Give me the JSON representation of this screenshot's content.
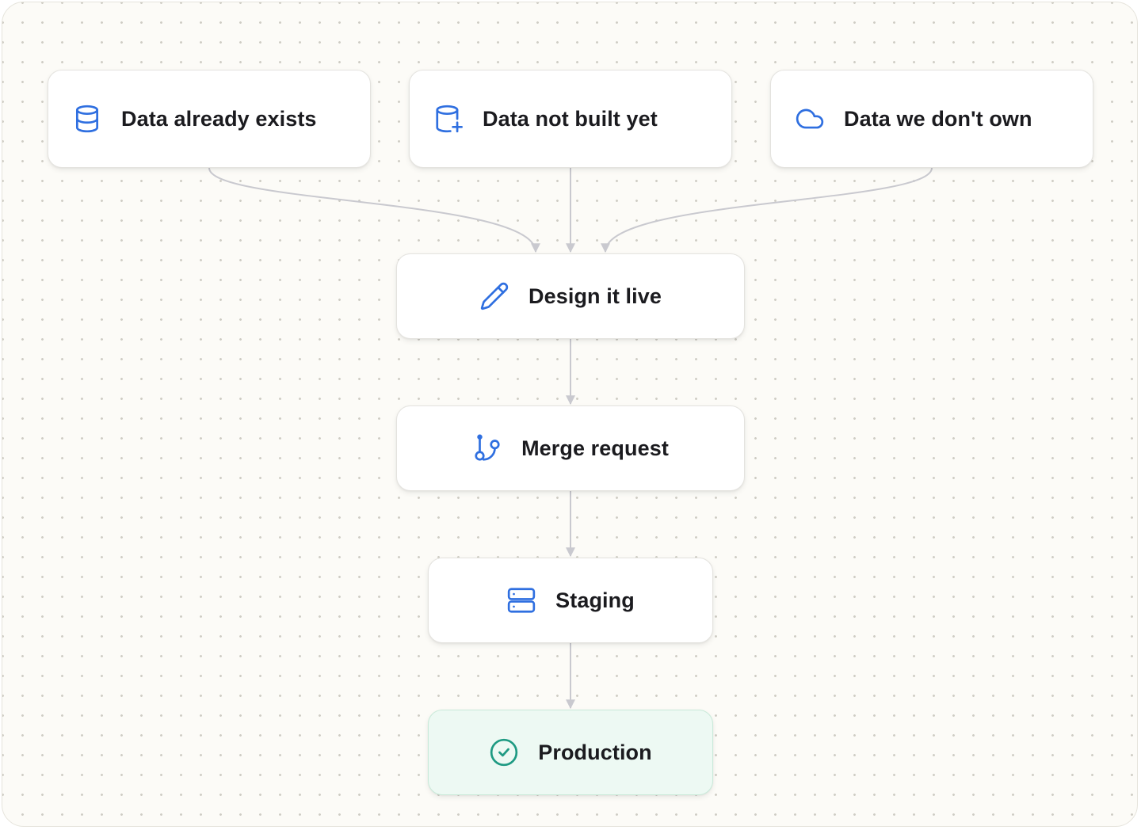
{
  "colors": {
    "icon_blue": "#2f6fe0",
    "icon_green": "#1e9a82",
    "edge": "#c9c9cf",
    "canvas_bg": "#fcfbf7",
    "production_bg": "#edf9f3"
  },
  "sources": [
    {
      "label": "Data already exists",
      "icon": "database-icon"
    },
    {
      "label": "Data not built yet",
      "icon": "database-plus-icon"
    },
    {
      "label": "Data we don't own",
      "icon": "cloud-icon"
    }
  ],
  "pipeline": [
    {
      "label": "Design it live",
      "icon": "pencil-icon"
    },
    {
      "label": "Merge request",
      "icon": "git-branch-icon"
    },
    {
      "label": "Staging",
      "icon": "server-icon"
    },
    {
      "label": "Production",
      "icon": "check-circle-icon"
    }
  ]
}
